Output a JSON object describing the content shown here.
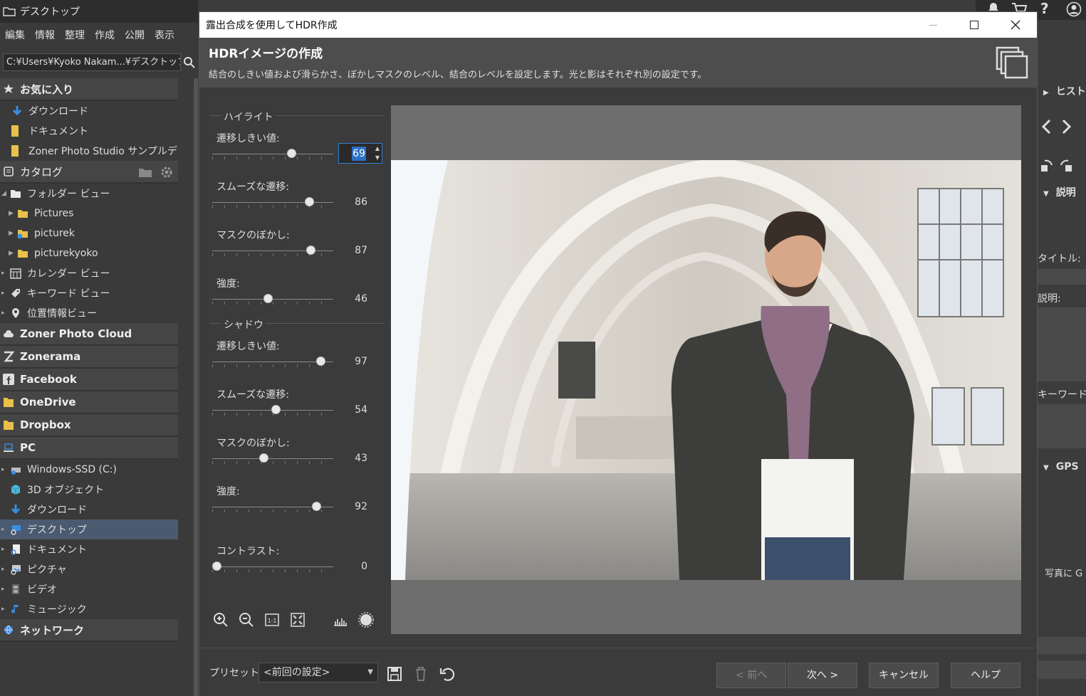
{
  "app": {
    "window_title": "デスクトップ",
    "menu": [
      "編集",
      "情報",
      "整理",
      "作成",
      "公開",
      "表示"
    ],
    "path": "C:¥Users¥Kyoko Nakam...¥デスクトップ"
  },
  "tree": {
    "favorites_header": "お気に入り",
    "favorites": [
      "ダウンロード",
      "ドキュメント",
      "Zoner Photo Studio サンプルデー..."
    ],
    "catalog_header": "カタログ",
    "folder_view": "フォルダー ビュー",
    "folders": [
      "Pictures",
      "picturek",
      "picturekyoko"
    ],
    "calendar_view": "カレンダー ビュー",
    "keyword_view": "キーワード ビュー",
    "location_view": "位置情報ビュー",
    "services": [
      "Zoner Photo Cloud",
      "Zonerama",
      "Facebook",
      "OneDrive",
      "Dropbox"
    ],
    "pc_header": "PC",
    "pc_items": [
      "Windows-SSD (C:)",
      "3D オブジェクト",
      "ダウンロード",
      "デスクトップ",
      "ドキュメント",
      "ピクチャ",
      "ビデオ",
      "ミュージック"
    ],
    "network_header": "ネットワーク"
  },
  "right_panel": {
    "history": "ヒスト",
    "description_header": "説明",
    "title_label": "タイトル:",
    "desc_label": "説明:",
    "keyword_label": "キーワード:",
    "gps_header": "GPS",
    "gps_text": "写真に G"
  },
  "dialog": {
    "title": "露出合成を使用してHDR作成",
    "heading": "HDRイメージの作成",
    "description": "結合のしきい値および滑らかさ、ぼかしマスクのレベル、結合のレベルを設定します。光と影はそれぞれ別の設定です。",
    "highlight_group": "ハイライト",
    "shadow_group": "シャドウ",
    "highlight": [
      {
        "label": "遷移しきい値:",
        "value": "69",
        "pct": 0.67
      },
      {
        "label": "スムーズな遷移:",
        "value": "86",
        "pct": 0.83
      },
      {
        "label": "マスクのぼかし:",
        "value": "87",
        "pct": 0.84
      },
      {
        "label": "強度:",
        "value": "46",
        "pct": 0.46
      }
    ],
    "shadow": [
      {
        "label": "遷移しきい値:",
        "value": "97",
        "pct": 0.93
      },
      {
        "label": "スムーズな遷移:",
        "value": "54",
        "pct": 0.53
      },
      {
        "label": "マスクのぼかし:",
        "value": "43",
        "pct": 0.42
      },
      {
        "label": "強度:",
        "value": "92",
        "pct": 0.89
      }
    ],
    "contrast": {
      "label": "コントラスト:",
      "value": "0",
      "pct": 0.0
    },
    "preset_label": "プリセット:",
    "preset_value": "<前回の設定>",
    "buttons": {
      "prev": "< 前へ",
      "next": "次へ >",
      "cancel": "キャンセル",
      "help": "ヘルプ"
    }
  }
}
